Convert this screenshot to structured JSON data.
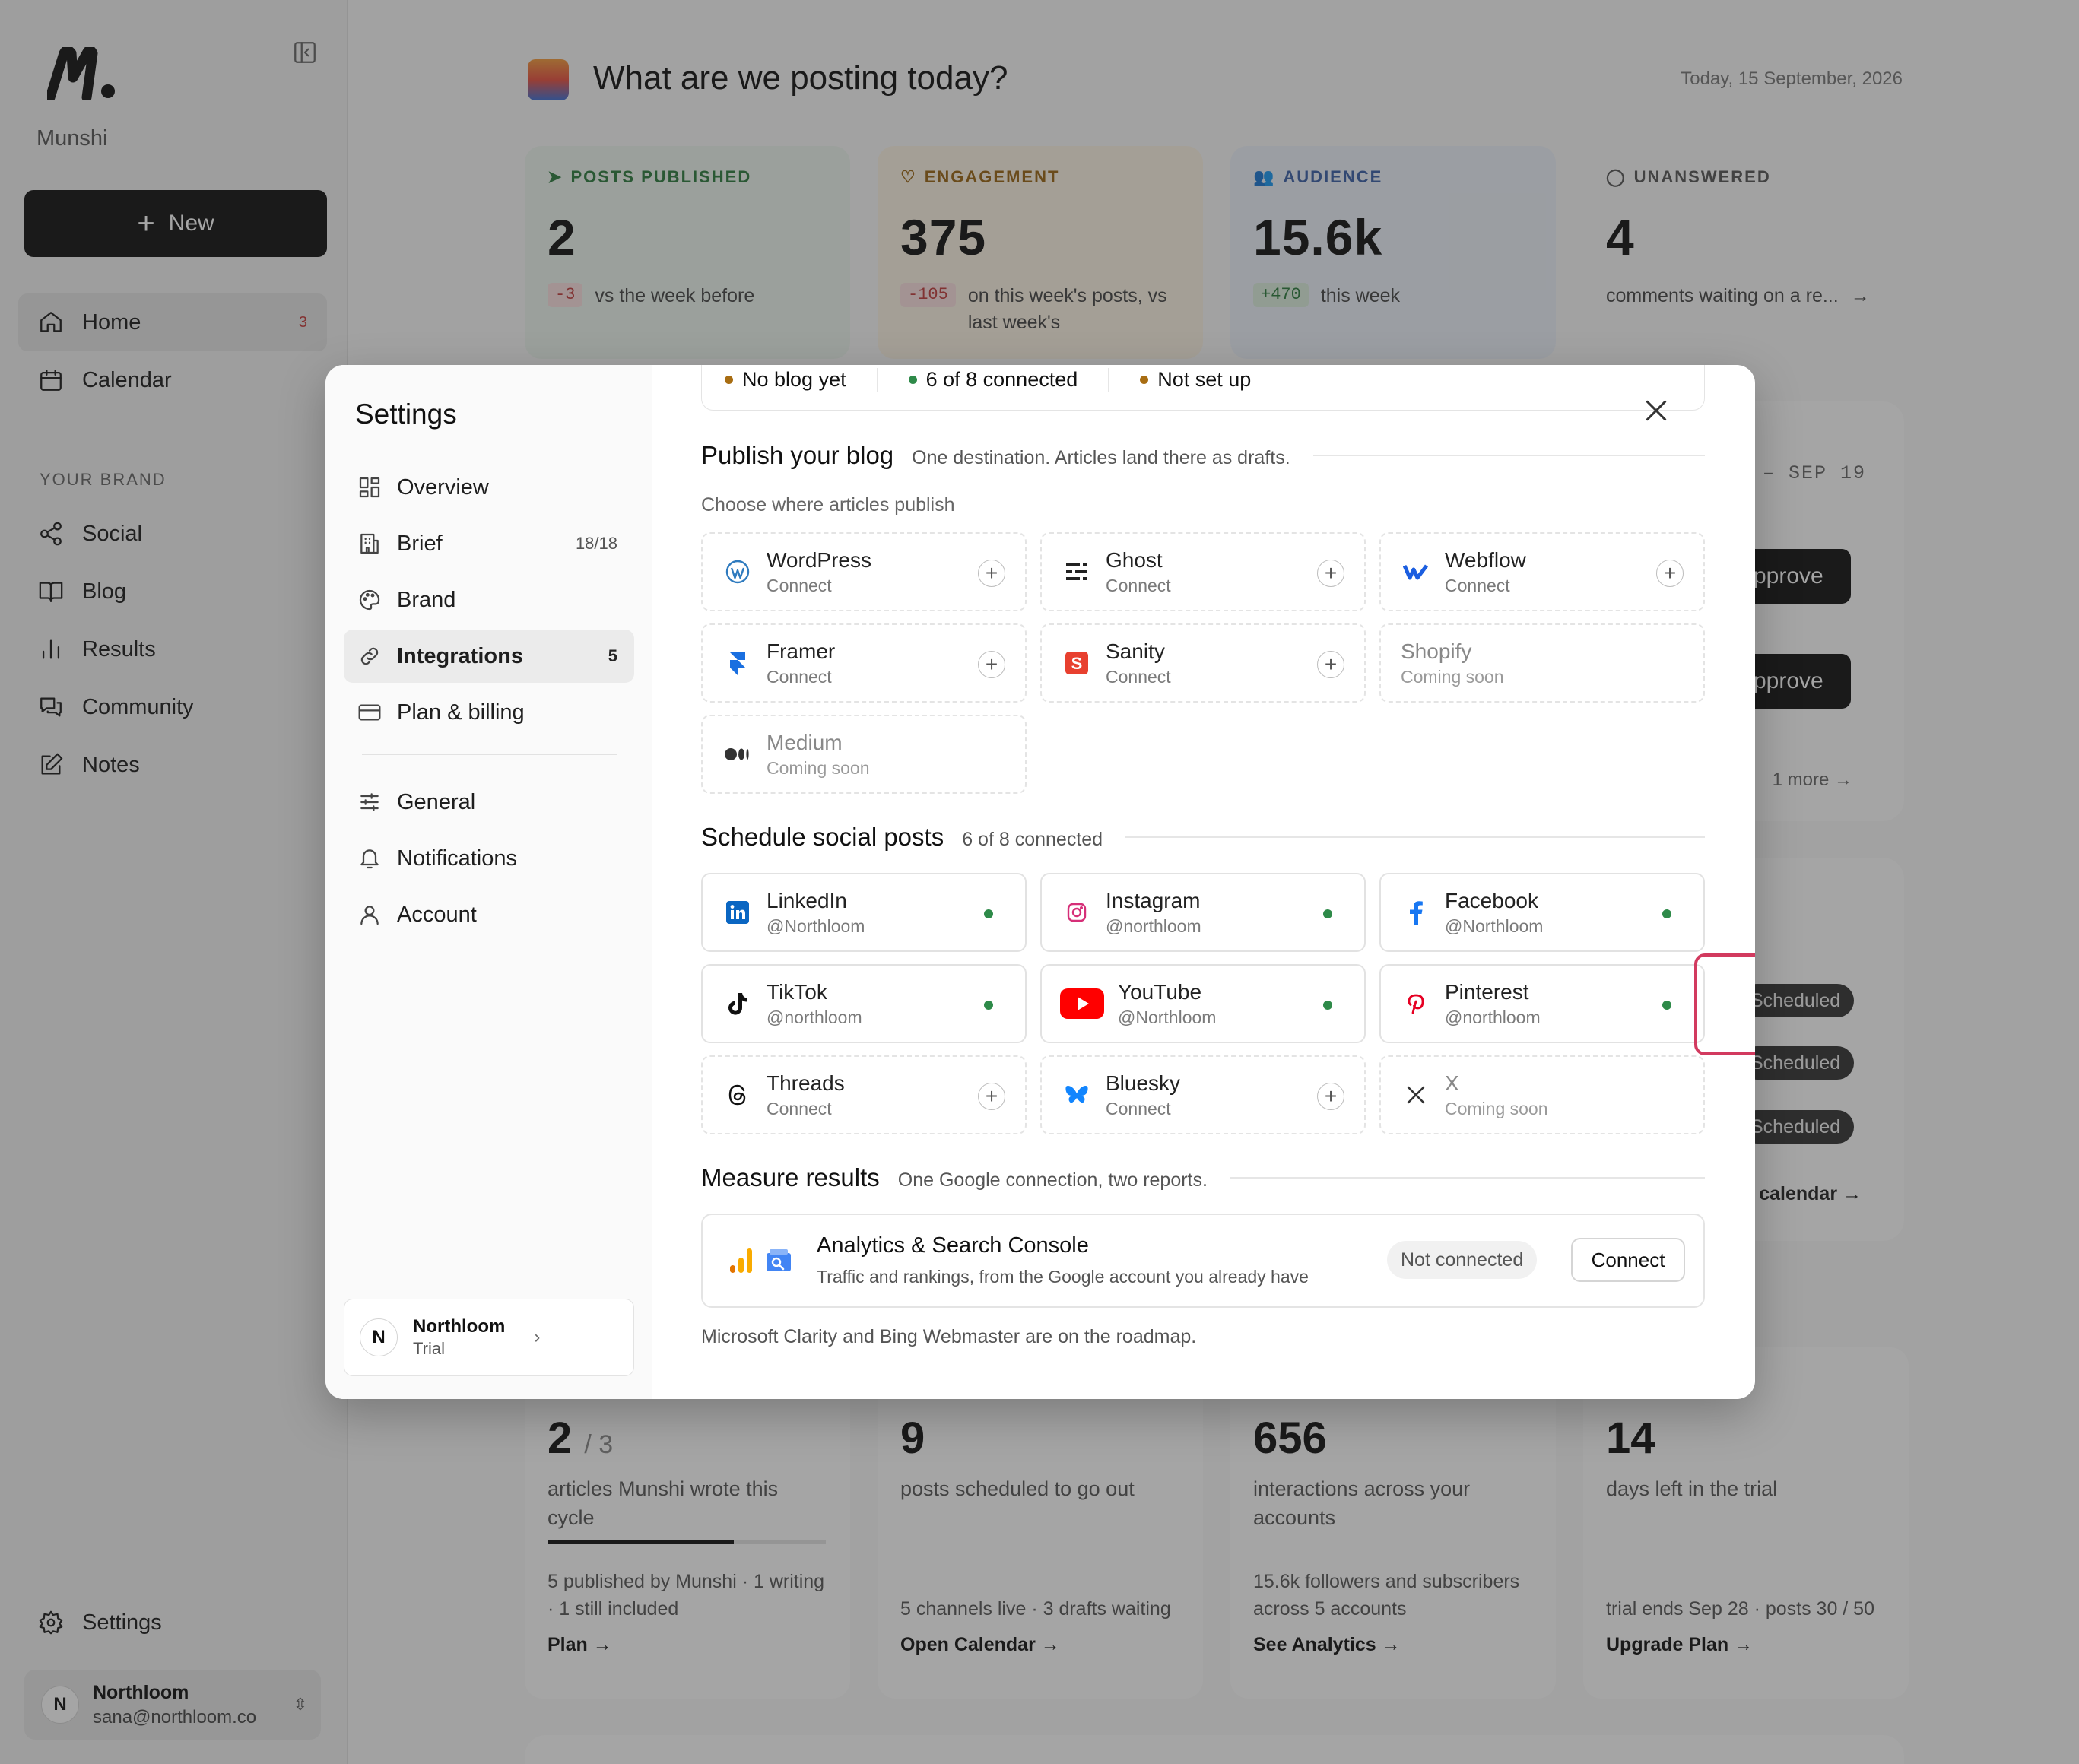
{
  "app": {
    "name": "Munshi",
    "new_label": "New"
  },
  "sidebar": {
    "main_items": [
      {
        "label": "Home",
        "count": "3"
      },
      {
        "label": "Calendar"
      }
    ],
    "section_label": "YOUR BRAND",
    "brand_items": [
      {
        "label": "Social"
      },
      {
        "label": "Blog"
      },
      {
        "label": "Results"
      },
      {
        "label": "Community"
      },
      {
        "label": "Notes"
      }
    ],
    "settings_label": "Settings",
    "user": {
      "initial": "N",
      "name": "Northloom",
      "email": "sana@northloom.co"
    }
  },
  "dashboard": {
    "title": "What are we posting today?",
    "date": "Today, 15 September, 2026",
    "stats": [
      {
        "label": "POSTS PUBLISHED",
        "value": "2",
        "delta": "-3",
        "note": "vs the week before"
      },
      {
        "label": "ENGAGEMENT",
        "value": "375",
        "delta": "-105",
        "note": "on this week's posts, vs last week's"
      },
      {
        "label": "AUDIENCE",
        "value": "15.6k",
        "delta": "+470",
        "note": "this week"
      },
      {
        "label": "UNANSWERED",
        "value": "4",
        "note": "comments waiting on a re..."
      }
    ],
    "week_range": "– SEP 19",
    "approve_label": "pprove",
    "more_label": "1 more",
    "scheduled_label": "Scheduled",
    "open_calendar": "en calendar →",
    "bottom": [
      {
        "value": "2",
        "of": "/ 3",
        "desc": "articles Munshi wrote this cycle",
        "foot": "5 published by Munshi · 1 writing · 1 still included",
        "link": "Plan →",
        "progress": 0.67
      },
      {
        "value": "9",
        "desc": "posts scheduled to go out",
        "foot": "5 channels live · 3 drafts waiting",
        "link": "Open Calendar →"
      },
      {
        "value": "656",
        "desc": "interactions across your accounts",
        "foot": "15.6k followers and subscribers across 5 accounts",
        "link": "See Analytics →"
      },
      {
        "value": "14",
        "desc": "days left in the trial",
        "foot": "trial ends Sep 28 · posts 30 / 50",
        "link": "Upgrade Plan →"
      }
    ]
  },
  "settings": {
    "title": "Settings",
    "nav": [
      {
        "label": "Overview",
        "icon": "grid-icon"
      },
      {
        "label": "Brief",
        "count": "18/18",
        "icon": "building-icon"
      },
      {
        "label": "Brand",
        "icon": "palette-icon"
      },
      {
        "label": "Integrations",
        "count": "5",
        "icon": "link-icon",
        "active": true
      },
      {
        "label": "Plan & billing",
        "icon": "card-icon"
      }
    ],
    "nav2": [
      {
        "label": "General",
        "icon": "sliders-icon"
      },
      {
        "label": "Notifications",
        "icon": "bell-icon"
      },
      {
        "label": "Account",
        "icon": "user-icon"
      }
    ],
    "workspace": {
      "initial": "N",
      "name": "Northloom",
      "plan": "Trial"
    },
    "status": [
      {
        "label": "No blog yet",
        "color": "#a86d12"
      },
      {
        "label": "6 of 8 connected",
        "color": "#2e8a49"
      },
      {
        "label": "Not set up",
        "color": "#a86d12"
      }
    ],
    "blog": {
      "title": "Publish your blog",
      "subtitle": "One destination. Articles land there as drafts.",
      "choose": "Choose where articles publish",
      "items": [
        {
          "name": "WordPress",
          "sub": "Connect"
        },
        {
          "name": "Ghost",
          "sub": "Connect"
        },
        {
          "name": "Webflow",
          "sub": "Connect"
        },
        {
          "name": "Framer",
          "sub": "Connect"
        },
        {
          "name": "Sanity",
          "sub": "Connect"
        },
        {
          "name": "Shopify",
          "sub": "Coming soon"
        },
        {
          "name": "Medium",
          "sub": "Coming soon"
        }
      ]
    },
    "social": {
      "title": "Schedule social posts",
      "subtitle": "6 of 8 connected",
      "items": [
        {
          "name": "LinkedIn",
          "sub": "@Northloom"
        },
        {
          "name": "Instagram",
          "sub": "@northloom"
        },
        {
          "name": "Facebook",
          "sub": "@Northloom"
        },
        {
          "name": "TikTok",
          "sub": "@northloom"
        },
        {
          "name": "YouTube",
          "sub": "@Northloom"
        },
        {
          "name": "Pinterest",
          "sub": "@northloom"
        },
        {
          "name": "Threads",
          "sub": "Connect"
        },
        {
          "name": "Bluesky",
          "sub": "Connect"
        },
        {
          "name": "X",
          "sub": "Coming soon"
        }
      ]
    },
    "measure": {
      "title": "Measure results",
      "subtitle": "One Google connection, two reports.",
      "name": "Analytics & Search Console",
      "desc": "Traffic and rankings, from the Google account you already have",
      "status": "Not connected",
      "button": "Connect",
      "footnote": "Microsoft Clarity and Bing Webmaster are on the roadmap."
    }
  }
}
